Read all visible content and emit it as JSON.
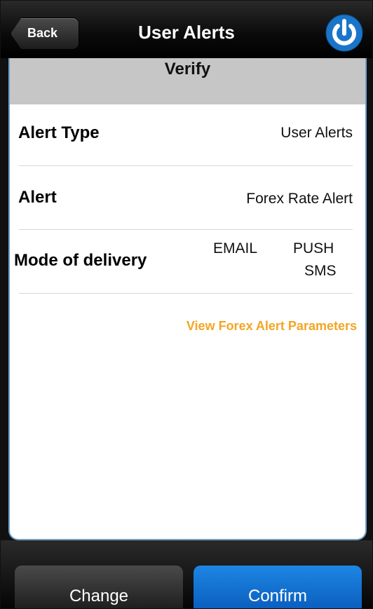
{
  "navbar": {
    "back_label": "Back",
    "title": "User Alerts",
    "power_icon": "power-icon"
  },
  "section": {
    "header": "Verify"
  },
  "rows": [
    {
      "label": "Alert Type",
      "value": "User Alerts"
    },
    {
      "label": "Alert",
      "value": "Forex Rate Alert"
    },
    {
      "label": "Mode of delivery",
      "values": [
        "EMAIL",
        "PUSH",
        "SMS"
      ]
    }
  ],
  "link": {
    "text": "View Forex Alert Parameters"
  },
  "actions": {
    "change_label": "Change",
    "confirm_label": "Confirm"
  },
  "colors": {
    "accent_link": "#f4a522",
    "confirm_button": "#1273d6",
    "header_bar": "#c6c6c6"
  }
}
